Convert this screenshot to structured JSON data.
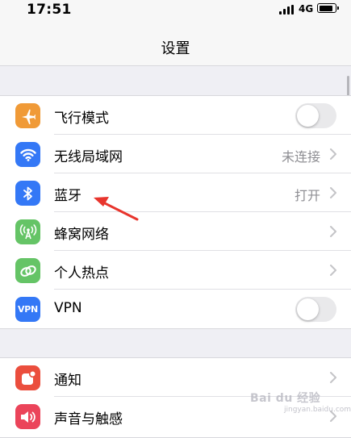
{
  "status_bar": {
    "time": "17:51",
    "network": "4G",
    "battery_level": 0.9
  },
  "nav": {
    "title": "设置"
  },
  "group1": [
    {
      "label": "飞行模式",
      "icon": "airplane-icon",
      "color": "#f09a37",
      "accessory": "toggle",
      "toggle_on": false
    },
    {
      "label": "无线局域网",
      "icon": "wifi-icon",
      "color": "#3478f6",
      "accessory": "value",
      "value": "未连接"
    },
    {
      "label": "蓝牙",
      "icon": "bluetooth-icon",
      "color": "#3478f6",
      "accessory": "value",
      "value": "打开"
    },
    {
      "label": "蜂窝网络",
      "icon": "cellular-antenna-icon",
      "color": "#65c466",
      "accessory": "chevron"
    },
    {
      "label": "个人热点",
      "icon": "hotspot-link-icon",
      "color": "#65c466",
      "accessory": "chevron"
    },
    {
      "label": "VPN",
      "icon": "vpn-icon",
      "icon_text": "VPN",
      "color": "#3478f6",
      "accessory": "toggle",
      "toggle_on": false
    }
  ],
  "group2": [
    {
      "label": "通知",
      "icon": "notifications-icon",
      "color": "#eb4e3d",
      "accessory": "chevron"
    },
    {
      "label": "声音与触感",
      "icon": "speaker-icon",
      "color": "#eb445a",
      "accessory": "chevron"
    }
  ],
  "annotation": {
    "color": "#e8352d",
    "target": "蓝牙"
  },
  "watermark": {
    "text": "Bai du 经验",
    "sub": "jingyan.baidu.com"
  }
}
